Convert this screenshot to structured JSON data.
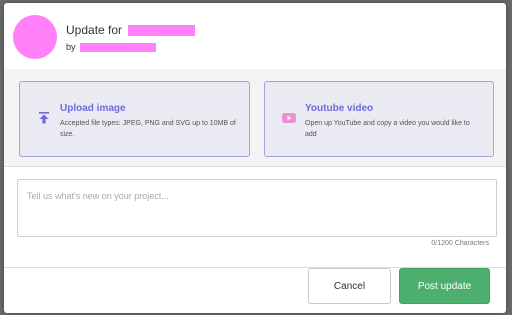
{
  "header": {
    "title_prefix": "Update for",
    "by_prefix": "by"
  },
  "media": {
    "upload": {
      "icon": "upload-icon",
      "title": "Upload image",
      "description": "Accepted file types: JPEG, PNG and SVG up to 10MB of size."
    },
    "youtube": {
      "icon": "youtube-icon",
      "title": "Youtube video",
      "description": "Open up YouTube and copy a video you would like to add"
    }
  },
  "composer": {
    "placeholder": "Tell us what's new on your project...",
    "counter": "0/1200 Characters"
  },
  "actions": {
    "cancel_label": "Cancel",
    "post_label": "Post update"
  },
  "colors": {
    "accent": "#6e6ad9",
    "redaction": "#ff80f7",
    "primary_button": "#4caf70"
  }
}
